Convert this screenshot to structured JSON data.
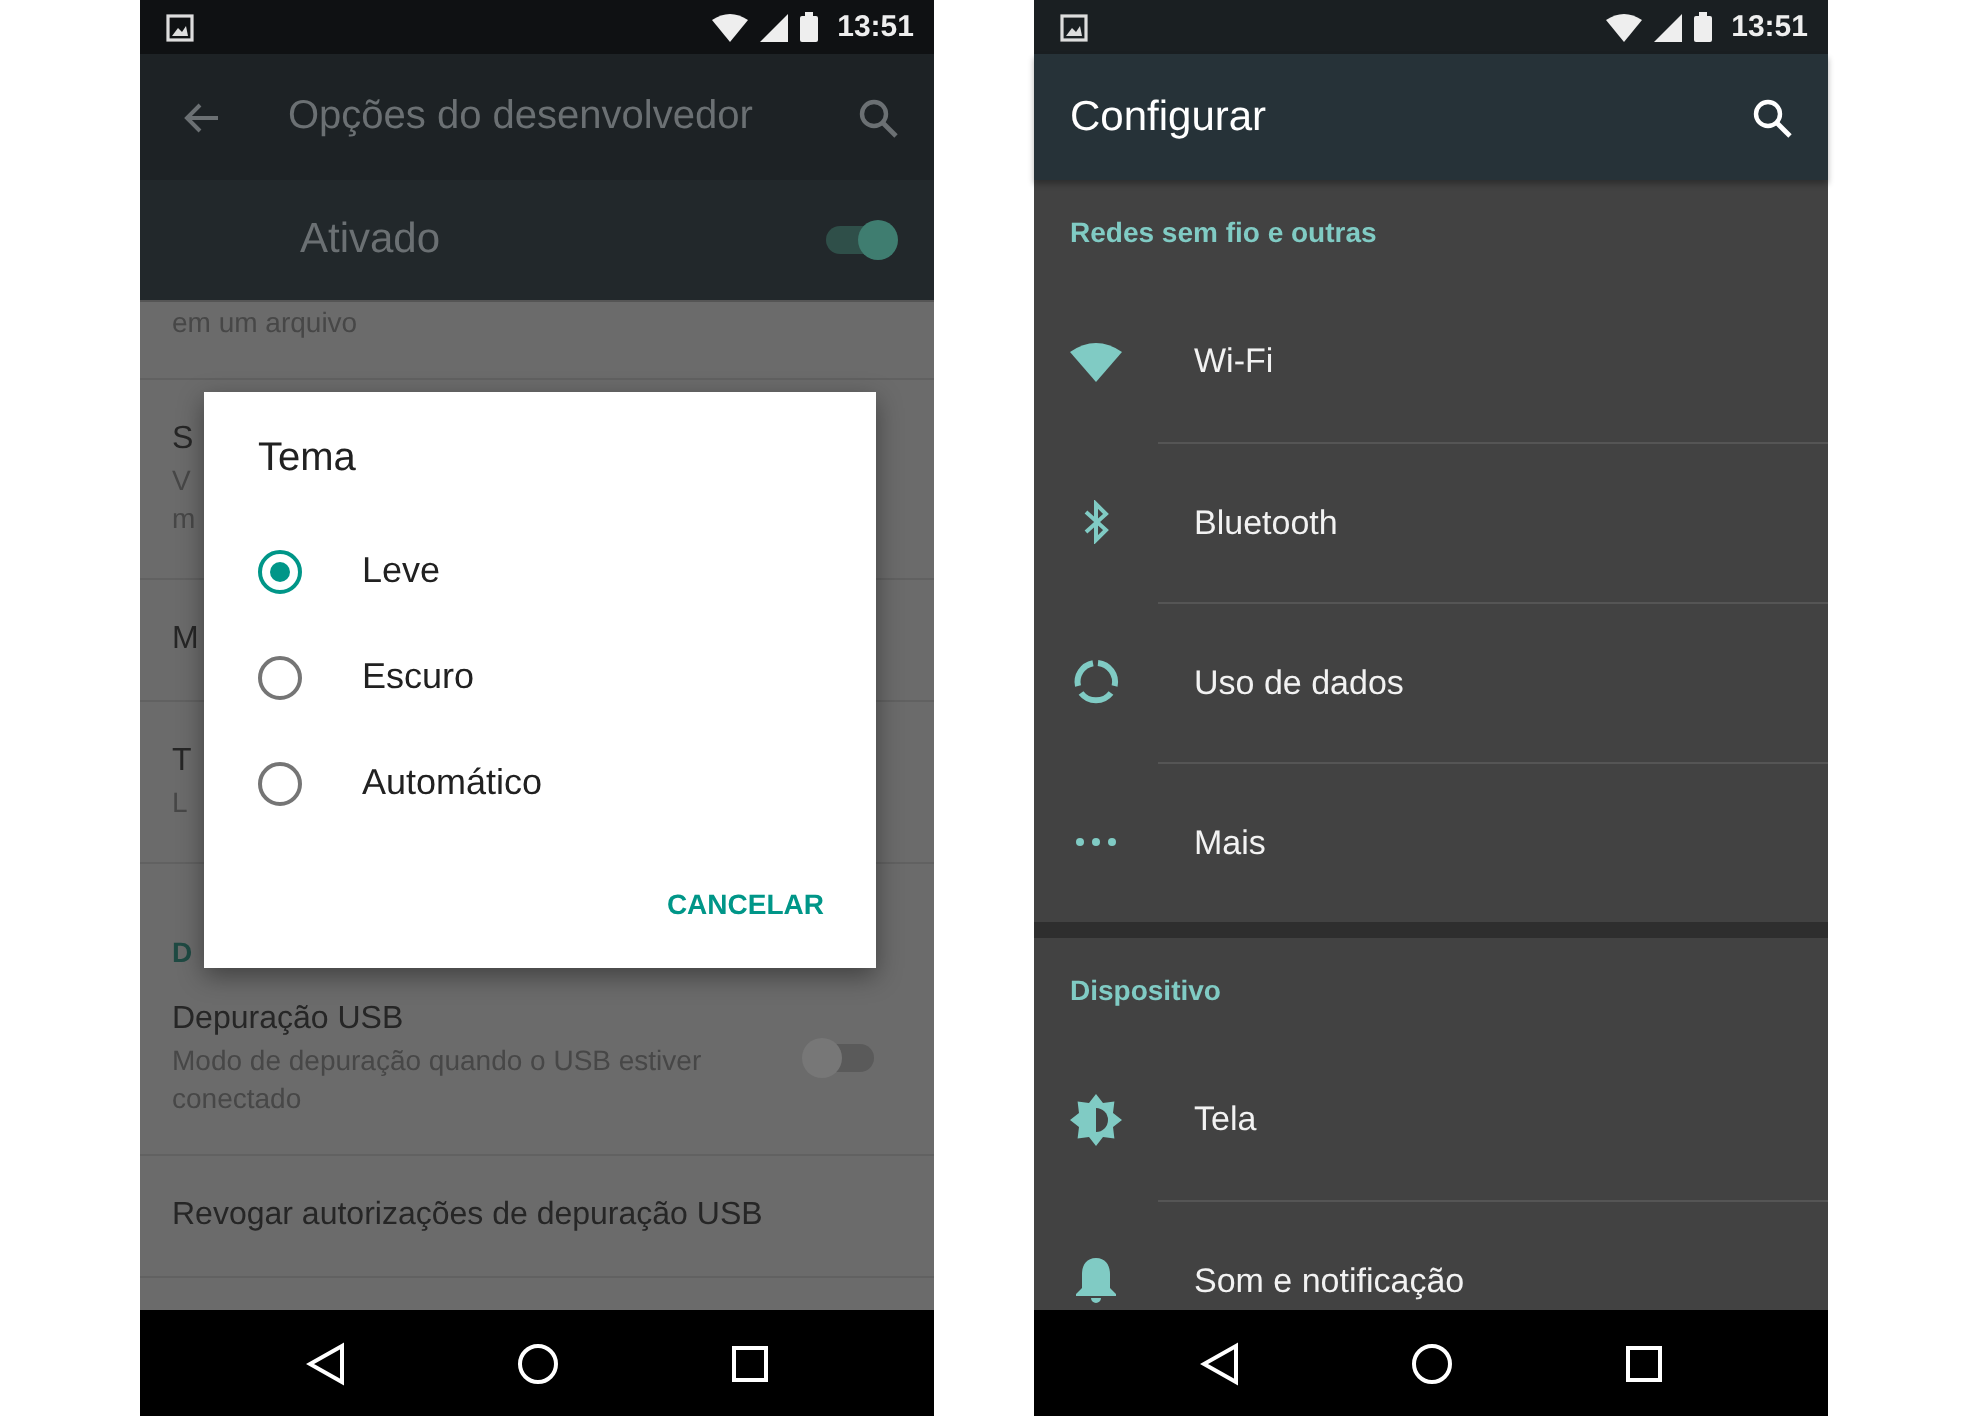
{
  "left_screen": {
    "status_bar": {
      "time": "13:51"
    },
    "toolbar": {
      "title": "Opções do desenvolvedor"
    },
    "master_switch": {
      "label": "Ativado",
      "on": true
    },
    "list": [
      {
        "kind": "tail",
        "summary_lines": [
          "em um arquivo"
        ]
      },
      {
        "kind": "item",
        "title": "S",
        "summary_lines": [
          "V",
          "m"
        ]
      },
      {
        "kind": "item",
        "title": "M"
      },
      {
        "kind": "item",
        "title": "T",
        "summary_lines": [
          "L"
        ]
      },
      {
        "kind": "header",
        "title": "D"
      },
      {
        "kind": "switch",
        "title": "Depuração USB",
        "summary": "Modo de depuração quando o USB estiver conectado",
        "on": false
      },
      {
        "kind": "item",
        "title": "Revogar autorizações de depuração USB"
      }
    ],
    "dialog": {
      "title": "Tema",
      "options": [
        {
          "label": "Leve",
          "selected": true
        },
        {
          "label": "Escuro",
          "selected": false
        },
        {
          "label": "Automático",
          "selected": false
        }
      ],
      "button": "CANCELAR"
    }
  },
  "right_screen": {
    "status_bar": {
      "time": "13:51"
    },
    "toolbar": {
      "title": "Configurar"
    },
    "sections": [
      {
        "title": "Redes sem fio e outras",
        "items": [
          {
            "label": "Wi-Fi"
          },
          {
            "label": "Bluetooth"
          },
          {
            "label": "Uso de dados"
          },
          {
            "label": "Mais"
          }
        ]
      },
      {
        "title": "Dispositivo",
        "items": [
          {
            "label": "Tela"
          },
          {
            "label": "Som e notificação"
          }
        ]
      }
    ]
  }
}
